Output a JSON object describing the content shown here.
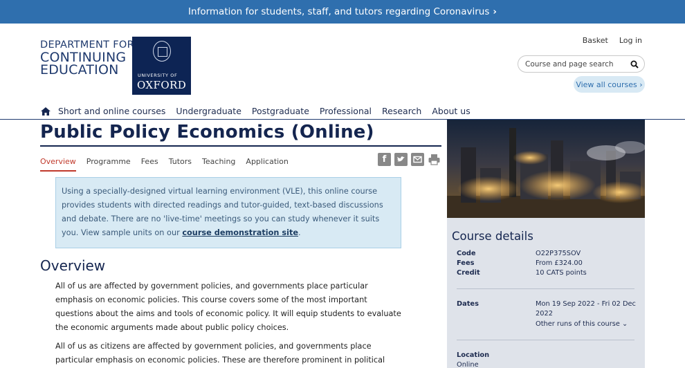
{
  "banner": {
    "text": "Information for students, staff, and tutors regarding Coronavirus",
    "chevron": "›"
  },
  "logo": {
    "dept_line1": "DEPARTMENT FOR",
    "dept_line2": "CONTINUING",
    "dept_line3": "EDUCATION",
    "uni_small": "UNIVERSITY OF",
    "uni_big": "OXFORD"
  },
  "top_links": {
    "basket": "Basket",
    "login": "Log in"
  },
  "search": {
    "placeholder": "Course and page search",
    "icon": "search-icon"
  },
  "view_all": "View all courses ›",
  "nav": {
    "home_icon": "home-icon",
    "items": [
      "Short and online courses",
      "Undergraduate",
      "Postgraduate",
      "Professional",
      "Research",
      "About us"
    ]
  },
  "page": {
    "title": "Public Policy Economics (Online)",
    "tabs": [
      "Overview",
      "Programme",
      "Fees",
      "Tutors",
      "Teaching",
      "Application"
    ],
    "active_tab": "Overview",
    "share_icons": [
      "facebook-icon",
      "twitter-icon",
      "email-icon",
      "print-icon"
    ],
    "notice_text": "Using a specially-designed virtual learning environment (VLE), this online course provides students with directed readings and tutor-guided, text-based discussions and debate. There are no 'live-time' meetings so you can study whenever it suits you. View sample units on our ",
    "notice_link": "course demonstration site",
    "notice_end": ".",
    "overview_heading": "Overview",
    "para1": "All of us are affected by government policies, and governments place particular emphasis on economic policies. This course covers some of the most important questions about the aims and tools of economic policy. It will equip students to evaluate the economic arguments made about public policy choices.",
    "para2": "All of us as citizens are affected by government policies, and governments place particular emphasis on economic policies. These are therefore prominent in political debate and in the"
  },
  "course_details": {
    "heading": "Course details",
    "code_label": "Code",
    "code_value": "O22P375SOV",
    "fees_label": "Fees",
    "fees_value": "From £324.00",
    "credit_label": "Credit",
    "credit_value": "10 CATS points",
    "dates_label": "Dates",
    "dates_value_1": "Mon 19 Sep 2022 - Fri 02 Dec",
    "dates_value_2": "2022",
    "other_runs": "Other runs of this course ⌄",
    "location_label": "Location",
    "location_value": "Online"
  },
  "colors": {
    "banner": "#2f6fae",
    "navy": "#14254f",
    "active_tab": "#c0392b",
    "notice_bg": "#d8eaf4",
    "details_bg": "#dfe3ea"
  }
}
